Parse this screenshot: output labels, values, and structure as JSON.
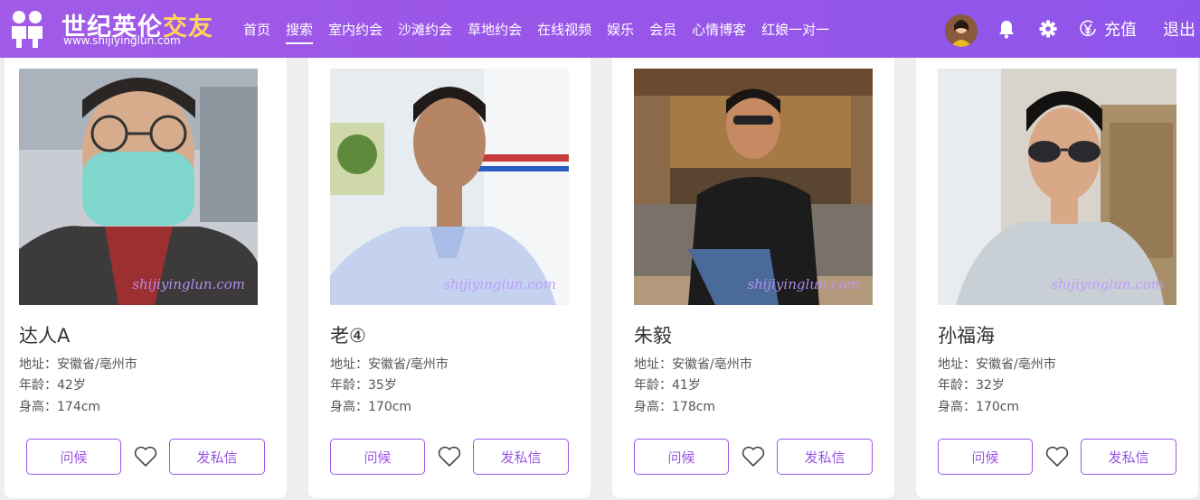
{
  "brand": {
    "name_main": "世纪英伦",
    "name_highlight": "交友",
    "url": "www.shijiyinglun.com"
  },
  "nav": [
    {
      "label": "首页",
      "active": false
    },
    {
      "label": "搜索",
      "active": true
    },
    {
      "label": "室内约会",
      "active": false
    },
    {
      "label": "沙滩约会",
      "active": false
    },
    {
      "label": "草地约会",
      "active": false
    },
    {
      "label": "在线视频",
      "active": false
    },
    {
      "label": "娱乐",
      "active": false
    },
    {
      "label": "会员",
      "active": false
    },
    {
      "label": "心情博客",
      "active": false
    },
    {
      "label": "红娘一对一",
      "active": false
    }
  ],
  "header_tools": {
    "recharge_label": "充值",
    "logout_label": "退出",
    "icons": [
      "user-avatar",
      "bell-icon",
      "gear-icon",
      "yen-icon"
    ]
  },
  "colors": {
    "brand_purple": "#9b55e6",
    "highlight_yellow": "#ffd35c",
    "watermark": "#be96ff"
  },
  "watermark_text": "shijiyinglun.com",
  "cards": [
    {
      "name": "达人A",
      "address": "地址：安徽省/亳州市",
      "age": "年龄：42岁",
      "height": "身高：174cm",
      "greet": "问候",
      "message": "发私信"
    },
    {
      "name": "老④",
      "address": "地址：安徽省/亳州市",
      "age": "年龄：35岁",
      "height": "身高：170cm",
      "greet": "问候",
      "message": "发私信"
    },
    {
      "name": "朱毅",
      "address": "地址：安徽省/亳州市",
      "age": "年龄：41岁",
      "height": "身高：178cm",
      "greet": "问候",
      "message": "发私信"
    },
    {
      "name": "孙福海",
      "address": "地址：安徽省/亳州市",
      "age": "年龄：32岁",
      "height": "身高：170cm",
      "greet": "问候",
      "message": "发私信"
    }
  ]
}
